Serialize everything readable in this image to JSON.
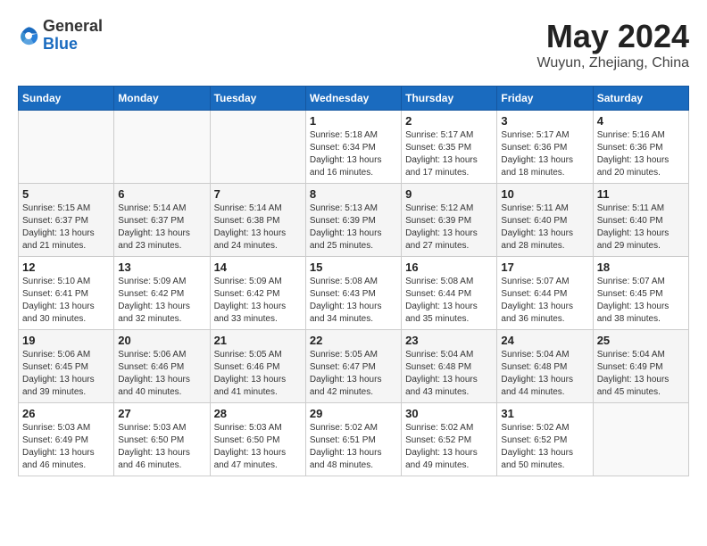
{
  "header": {
    "logo_general": "General",
    "logo_blue": "Blue",
    "main_title": "May 2024",
    "subtitle": "Wuyun, Zhejiang, China"
  },
  "calendar": {
    "days_of_week": [
      "Sunday",
      "Monday",
      "Tuesday",
      "Wednesday",
      "Thursday",
      "Friday",
      "Saturday"
    ],
    "weeks": [
      [
        {
          "day": "",
          "info": ""
        },
        {
          "day": "",
          "info": ""
        },
        {
          "day": "",
          "info": ""
        },
        {
          "day": "1",
          "info": "Sunrise: 5:18 AM\nSunset: 6:34 PM\nDaylight: 13 hours\nand 16 minutes."
        },
        {
          "day": "2",
          "info": "Sunrise: 5:17 AM\nSunset: 6:35 PM\nDaylight: 13 hours\nand 17 minutes."
        },
        {
          "day": "3",
          "info": "Sunrise: 5:17 AM\nSunset: 6:36 PM\nDaylight: 13 hours\nand 18 minutes."
        },
        {
          "day": "4",
          "info": "Sunrise: 5:16 AM\nSunset: 6:36 PM\nDaylight: 13 hours\nand 20 minutes."
        }
      ],
      [
        {
          "day": "5",
          "info": "Sunrise: 5:15 AM\nSunset: 6:37 PM\nDaylight: 13 hours\nand 21 minutes."
        },
        {
          "day": "6",
          "info": "Sunrise: 5:14 AM\nSunset: 6:37 PM\nDaylight: 13 hours\nand 23 minutes."
        },
        {
          "day": "7",
          "info": "Sunrise: 5:14 AM\nSunset: 6:38 PM\nDaylight: 13 hours\nand 24 minutes."
        },
        {
          "day": "8",
          "info": "Sunrise: 5:13 AM\nSunset: 6:39 PM\nDaylight: 13 hours\nand 25 minutes."
        },
        {
          "day": "9",
          "info": "Sunrise: 5:12 AM\nSunset: 6:39 PM\nDaylight: 13 hours\nand 27 minutes."
        },
        {
          "day": "10",
          "info": "Sunrise: 5:11 AM\nSunset: 6:40 PM\nDaylight: 13 hours\nand 28 minutes."
        },
        {
          "day": "11",
          "info": "Sunrise: 5:11 AM\nSunset: 6:40 PM\nDaylight: 13 hours\nand 29 minutes."
        }
      ],
      [
        {
          "day": "12",
          "info": "Sunrise: 5:10 AM\nSunset: 6:41 PM\nDaylight: 13 hours\nand 30 minutes."
        },
        {
          "day": "13",
          "info": "Sunrise: 5:09 AM\nSunset: 6:42 PM\nDaylight: 13 hours\nand 32 minutes."
        },
        {
          "day": "14",
          "info": "Sunrise: 5:09 AM\nSunset: 6:42 PM\nDaylight: 13 hours\nand 33 minutes."
        },
        {
          "day": "15",
          "info": "Sunrise: 5:08 AM\nSunset: 6:43 PM\nDaylight: 13 hours\nand 34 minutes."
        },
        {
          "day": "16",
          "info": "Sunrise: 5:08 AM\nSunset: 6:44 PM\nDaylight: 13 hours\nand 35 minutes."
        },
        {
          "day": "17",
          "info": "Sunrise: 5:07 AM\nSunset: 6:44 PM\nDaylight: 13 hours\nand 36 minutes."
        },
        {
          "day": "18",
          "info": "Sunrise: 5:07 AM\nSunset: 6:45 PM\nDaylight: 13 hours\nand 38 minutes."
        }
      ],
      [
        {
          "day": "19",
          "info": "Sunrise: 5:06 AM\nSunset: 6:45 PM\nDaylight: 13 hours\nand 39 minutes."
        },
        {
          "day": "20",
          "info": "Sunrise: 5:06 AM\nSunset: 6:46 PM\nDaylight: 13 hours\nand 40 minutes."
        },
        {
          "day": "21",
          "info": "Sunrise: 5:05 AM\nSunset: 6:46 PM\nDaylight: 13 hours\nand 41 minutes."
        },
        {
          "day": "22",
          "info": "Sunrise: 5:05 AM\nSunset: 6:47 PM\nDaylight: 13 hours\nand 42 minutes."
        },
        {
          "day": "23",
          "info": "Sunrise: 5:04 AM\nSunset: 6:48 PM\nDaylight: 13 hours\nand 43 minutes."
        },
        {
          "day": "24",
          "info": "Sunrise: 5:04 AM\nSunset: 6:48 PM\nDaylight: 13 hours\nand 44 minutes."
        },
        {
          "day": "25",
          "info": "Sunrise: 5:04 AM\nSunset: 6:49 PM\nDaylight: 13 hours\nand 45 minutes."
        }
      ],
      [
        {
          "day": "26",
          "info": "Sunrise: 5:03 AM\nSunset: 6:49 PM\nDaylight: 13 hours\nand 46 minutes."
        },
        {
          "day": "27",
          "info": "Sunrise: 5:03 AM\nSunset: 6:50 PM\nDaylight: 13 hours\nand 46 minutes."
        },
        {
          "day": "28",
          "info": "Sunrise: 5:03 AM\nSunset: 6:50 PM\nDaylight: 13 hours\nand 47 minutes."
        },
        {
          "day": "29",
          "info": "Sunrise: 5:02 AM\nSunset: 6:51 PM\nDaylight: 13 hours\nand 48 minutes."
        },
        {
          "day": "30",
          "info": "Sunrise: 5:02 AM\nSunset: 6:52 PM\nDaylight: 13 hours\nand 49 minutes."
        },
        {
          "day": "31",
          "info": "Sunrise: 5:02 AM\nSunset: 6:52 PM\nDaylight: 13 hours\nand 50 minutes."
        },
        {
          "day": "",
          "info": ""
        }
      ]
    ]
  }
}
